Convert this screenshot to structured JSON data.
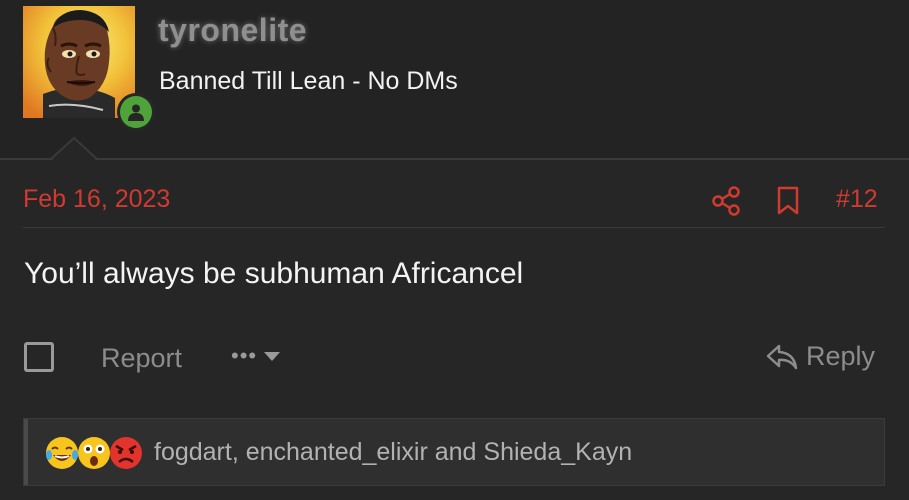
{
  "post": {
    "username": "tyronelite",
    "user_title": "Banned Till Lean - No DMs",
    "date": "Feb 16, 2023",
    "post_number": "#12",
    "message": "You’ll always be subhuman Africancel",
    "report_label": "Report",
    "more_label": "•••",
    "reply_label": "Reply",
    "reactors": "fogdart, enchanted_elixir and Shieda_Kayn"
  },
  "reactions": [
    "crying-laughing",
    "astonished",
    "angry"
  ],
  "colors": {
    "accent_red": "#d03a30",
    "online_green": "#4fa33a",
    "background": "#262626"
  }
}
